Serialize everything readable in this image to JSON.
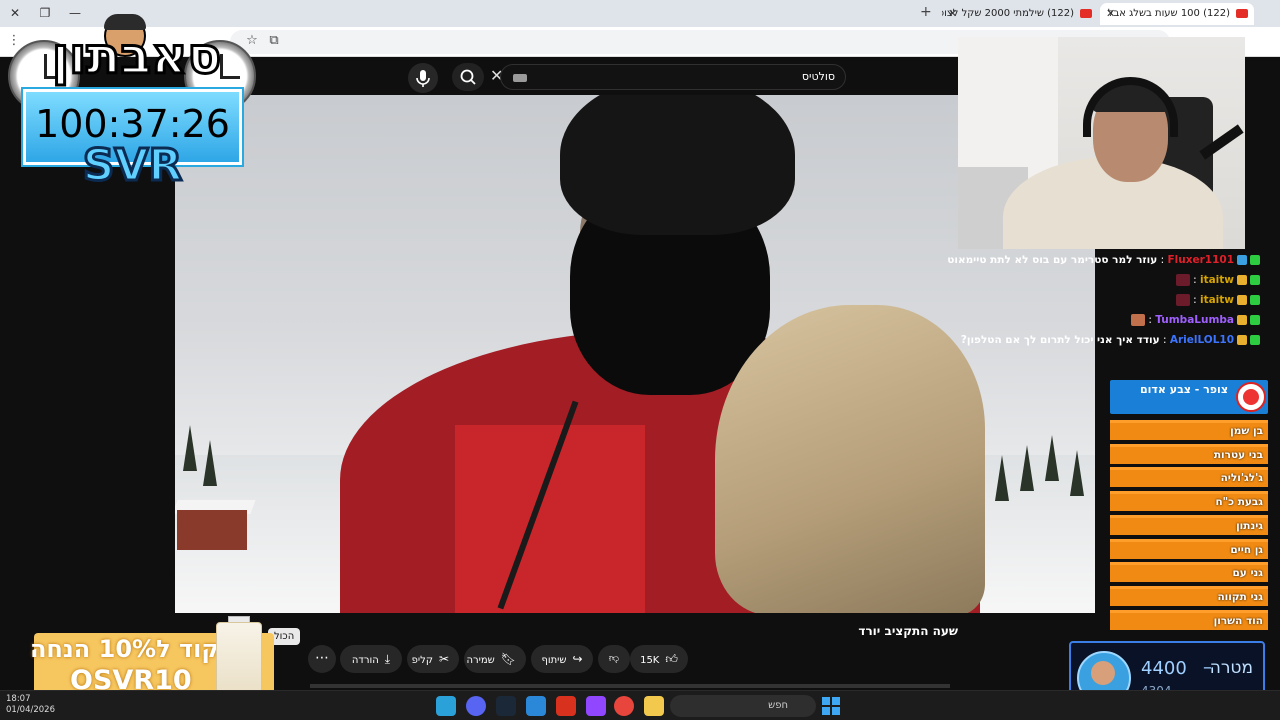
{
  "browser": {
    "tabs": [
      {
        "label": "(122) 100 שעות בשלג אבל",
        "active": true
      },
      {
        "label": "(122) שילמתי 2000 שקל לצופי",
        "active": false
      }
    ]
  },
  "youtube": {
    "search_query": "סולטיס",
    "video_title": "שעה התקציב יורד",
    "likes": "15K",
    "actions": {
      "share": "שיתוף",
      "save": "שמירה",
      "clip": "קליפ",
      "download": "הורדה"
    },
    "tooltip": "הכול"
  },
  "overlay": {
    "logo": "סאבתון",
    "timer": "100:37:26",
    "tag": "SVR"
  },
  "chat": [
    {
      "user": "Fluxer1101",
      "user_color": "#e0202a",
      "message": "עוזר למר סטרימר עם בוס לא לתת טיימאוט",
      "emote": false
    },
    {
      "user": "itaitw",
      "user_color": "#d6a400",
      "message": "",
      "emote": true
    },
    {
      "user": "itaitw",
      "user_color": "#d6a400",
      "message": "",
      "emote": true
    },
    {
      "user": "TumbaLumba",
      "user_color": "#a060ff",
      "message": "",
      "emote": true
    },
    {
      "user": "ArielLOL10",
      "user_color": "#3d74ff",
      "message": "עודד איך אני יכול לתרום לך אם הטלפון?",
      "emote": false
    }
  ],
  "team_list": {
    "header": "צופר - צבע אדום",
    "items": [
      "בן שמן",
      "בני עטרות",
      "ג'לג'וליה",
      "גבעת כ\"ח",
      "גינתון",
      "גן חיים",
      "גני עם",
      "גני תקווה",
      "הוד השרון"
    ]
  },
  "goal": {
    "label": "מטרה",
    "target": "4400",
    "current": "4304"
  },
  "promo": {
    "line1": "קוד ל10% הנחה",
    "code": "OSVR10"
  },
  "taskbar": {
    "time": "18:07",
    "date": "01/04/2026",
    "search_placeholder": "חפש"
  },
  "colors": {
    "accent_red": "#e52d27",
    "list_orange": "#f08a12",
    "list_header_blue": "#1a7fd6",
    "timer_blue": "#2ea6e6"
  }
}
